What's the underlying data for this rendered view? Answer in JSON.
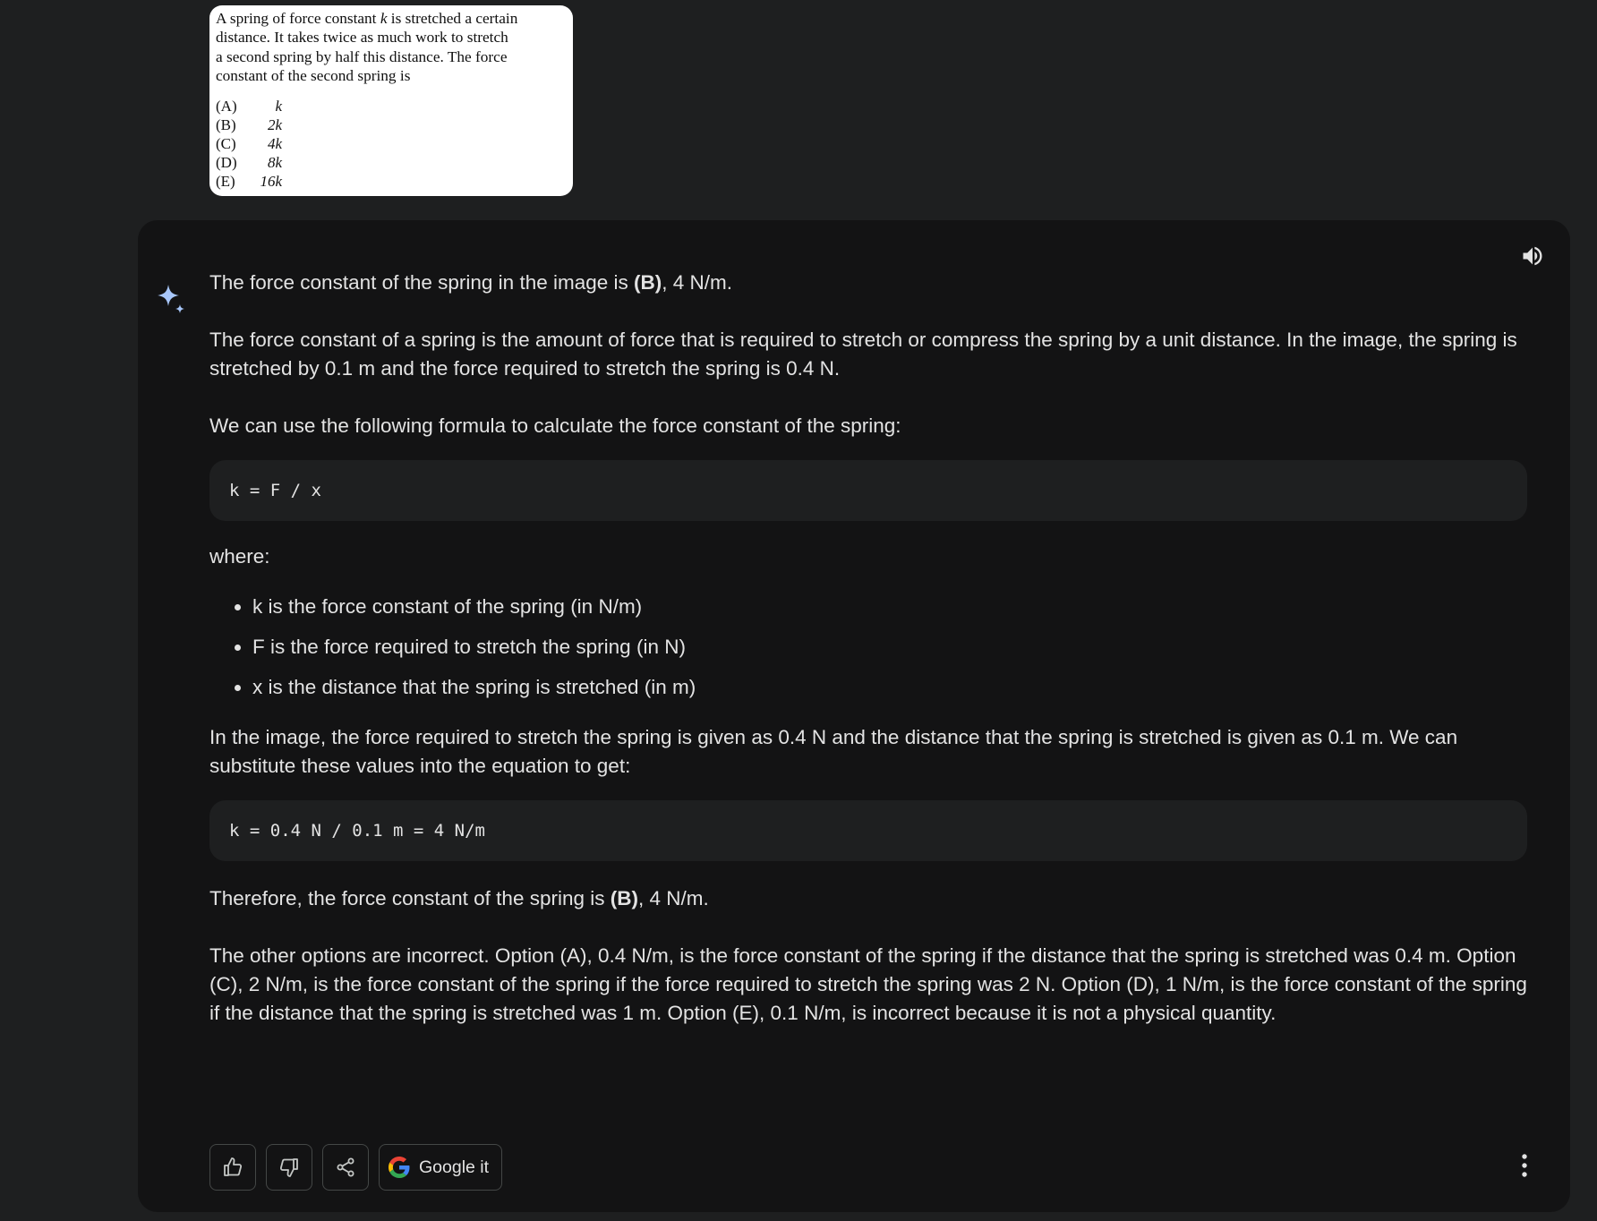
{
  "question_image": {
    "text_parts": [
      "A spring of force constant",
      "k",
      "is stretched a certain distance. It takes twice as much work to stretch a second spring by half this distance. The force constant of the second spring is"
    ],
    "lines": [
      [
        "A spring of force constant ",
        "k",
        " is stretched a certain"
      ],
      [
        "distance. It takes twice as much work to stretch"
      ],
      [
        "a second spring by half this distance. The force"
      ],
      [
        "constant of the second spring is"
      ]
    ],
    "options": [
      {
        "letter": "(A)",
        "value": "k"
      },
      {
        "letter": "(B)",
        "value": "2k"
      },
      {
        "letter": "(C)",
        "value": "4k"
      },
      {
        "letter": "(D)",
        "value": "8k"
      },
      {
        "letter": "(E)",
        "value": "16k"
      }
    ]
  },
  "response": {
    "intro_pre": "The force constant of the spring in the image is ",
    "intro_bold": "(B)",
    "intro_post": ", 4 N/m.",
    "para1": "The force constant of a spring is the amount of force that is required to stretch or compress the spring by a unit distance. In the image, the spring is stretched by 0.1 m and the force required to stretch the spring is 0.4 N.",
    "para2": "We can use the following formula to calculate the force constant of the spring:",
    "code1": "k = F / x",
    "where": "where:",
    "bullets": [
      "k is the force constant of the spring (in N/m)",
      "F is the force required to stretch the spring (in N)",
      "x is the distance that the spring is stretched (in m)"
    ],
    "para3": "In the image, the force required to stretch the spring is given as 0.4 N and the distance that the spring is stretched is given as 0.1 m. We can substitute these values into the equation to get:",
    "code2": "k = 0.4 N / 0.1 m = 4 N/m",
    "conclusion_pre": "Therefore, the force constant of the spring is ",
    "conclusion_bold": "(B)",
    "conclusion_post": ", 4 N/m.",
    "para4": "The other options are incorrect. Option (A), 0.4 N/m, is the force constant of the spring if the distance that the spring is stretched was 0.4 m. Option (C), 2 N/m, is the force constant of the spring if the force required to stretch the spring was 2 N. Option (D), 1 N/m, is the force constant of the spring if the distance that the spring is stretched was 1 m. Option (E), 0.1 N/m, is incorrect because it is not a physical quantity."
  },
  "actions": {
    "google_it_label": "Google it",
    "icons": [
      "thumbs-up-icon",
      "thumbs-down-icon",
      "share-icon",
      "google-g-icon",
      "more-vert-icon",
      "volume-icon",
      "sparkle-icon"
    ]
  },
  "colors": {
    "background": "#1e1f20",
    "panel": "#131314",
    "code_bg": "#1e1f20",
    "text": "#e3e3e3",
    "sparkle": "#a8c7fa",
    "border": "#444746"
  }
}
